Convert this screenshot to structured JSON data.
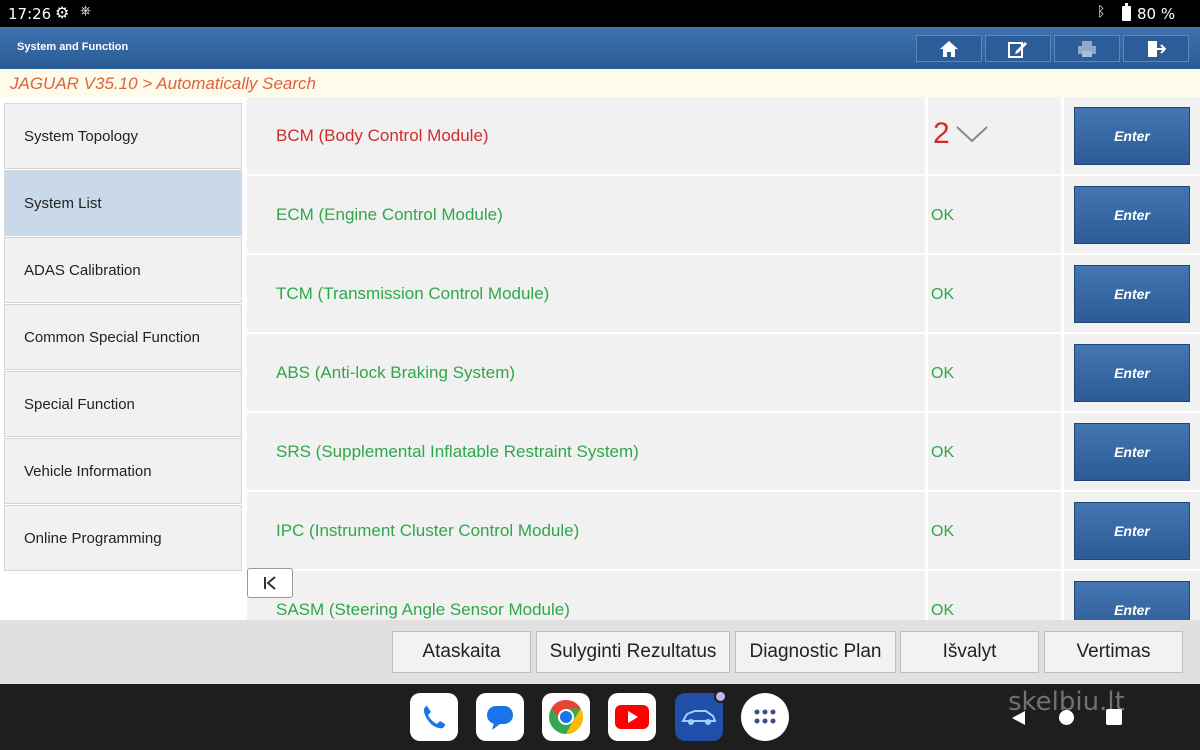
{
  "status_bar": {
    "time": "17:26",
    "battery": "80 %"
  },
  "header": {
    "title": "System and Function"
  },
  "breadcrumb": "JAGUAR V35.10 > Automatically Search",
  "sidebar": {
    "items": [
      {
        "label": "System Topology",
        "active": false
      },
      {
        "label": "System List",
        "active": true
      },
      {
        "label": "ADAS Calibration",
        "active": false
      },
      {
        "label": "Common Special Function",
        "active": false
      },
      {
        "label": "Special Function",
        "active": false
      },
      {
        "label": "Vehicle Information",
        "active": false
      },
      {
        "label": "Online Programming",
        "active": false
      }
    ]
  },
  "systems": {
    "enter_label": "Enter",
    "rows": [
      {
        "name": "BCM (Body Control Module)",
        "status": "2",
        "fault": true
      },
      {
        "name": "ECM (Engine Control Module)",
        "status": "OK",
        "fault": false
      },
      {
        "name": "TCM (Transmission Control Module)",
        "status": "OK",
        "fault": false
      },
      {
        "name": "ABS (Anti-lock Braking System)",
        "status": "OK",
        "fault": false
      },
      {
        "name": "SRS (Supplemental Inflatable Restraint System)",
        "status": "OK",
        "fault": false
      },
      {
        "name": "IPC (Instrument Cluster Control Module)",
        "status": "OK",
        "fault": false
      },
      {
        "name": "SASM (Steering Angle Sensor Module)",
        "status": "OK",
        "fault": false
      }
    ]
  },
  "toolbar": {
    "report": "Ataskaita",
    "compare": "Sulyginti Rezultatus",
    "diagnostic_plan": "Diagnostic Plan",
    "clear": "Išvalyt",
    "translate": "Vertimas"
  },
  "watermark": "skelbiu.lt",
  "colors": {
    "header_blue": "#2a5a94",
    "ok_green": "#2ea84a",
    "fault_red": "#d12b2b",
    "crumb_orange": "#e0623e"
  }
}
